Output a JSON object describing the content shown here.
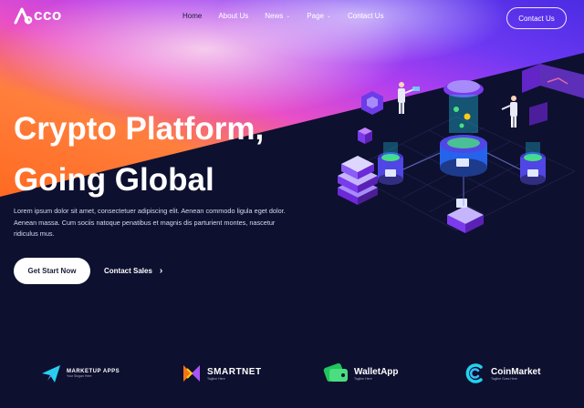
{
  "brand": {
    "logo_text": "cco"
  },
  "nav": {
    "items": [
      {
        "label": "Home",
        "active": true,
        "dropdown": false
      },
      {
        "label": "About Us",
        "active": false,
        "dropdown": false
      },
      {
        "label": "News",
        "active": false,
        "dropdown": true
      },
      {
        "label": "Page",
        "active": false,
        "dropdown": true
      },
      {
        "label": "Contact Us",
        "active": false,
        "dropdown": false
      }
    ],
    "cta_label": "Contact Us"
  },
  "hero": {
    "title_line1": "Crypto Platform,",
    "title_line2": "Going Global",
    "description": "Lorem ipsum dolor sit amet, consectetuer adipiscing elit. Aenean commodo ligula eget dolor. Aenean massa. Cum sociis natoque penatibus et magnis dis parturient montes, nascetur ridiculus mus.",
    "primary_button": "Get Start Now",
    "secondary_button": "Contact Sales"
  },
  "partners": [
    {
      "name": "MARKETUP APPS",
      "tagline": "Your Slogan Here",
      "icon": "paper-plane-icon"
    },
    {
      "name": "SMARTNET",
      "tagline": "Tagline Here",
      "icon": "smartnet-icon"
    },
    {
      "name": "WalletApp",
      "tagline": "Tagline Here",
      "icon": "wallet-icon"
    },
    {
      "name": "CoinMarket",
      "tagline": "Tagline Goes Here",
      "icon": "coin-c-icon"
    }
  ],
  "colors": {
    "background": "#0d0e2b",
    "gradient_orange": "#ff7a2f",
    "gradient_pink": "#e63fd0",
    "gradient_purple": "#7b3cf0",
    "accent_violet": "#8b5cf6"
  }
}
